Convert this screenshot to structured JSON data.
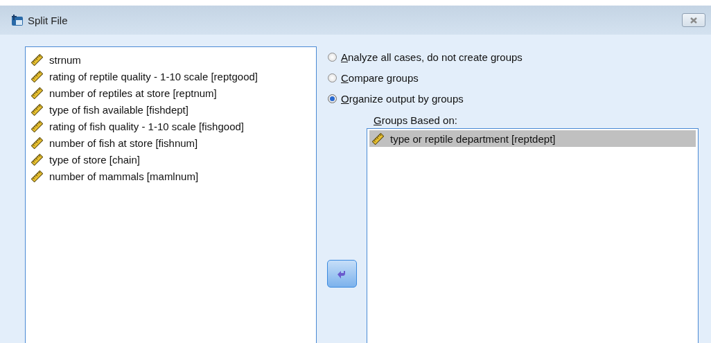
{
  "window": {
    "title": "Split File"
  },
  "variables": [
    {
      "label": "strnum",
      "selected": false
    },
    {
      "label": "rating of reptile quality - 1-10 scale [reptgood]",
      "selected": false
    },
    {
      "label": "number of reptiles at store [reptnum]",
      "selected": false
    },
    {
      "label": "type of fish available [fishdept]",
      "selected": false
    },
    {
      "label": "rating of fish quality - 1-10 scale [fishgood]",
      "selected": false
    },
    {
      "label": "number of fish at store [fishnum]",
      "selected": false
    },
    {
      "label": "type of store [chain]",
      "selected": false
    },
    {
      "label": "number of mammals [mamlnum]",
      "selected": false
    }
  ],
  "options": [
    {
      "label": "Analyze all cases, do not create groups",
      "selected": false
    },
    {
      "label": "Compare groups",
      "selected": false
    },
    {
      "label": "Organize output by groups",
      "selected": true
    }
  ],
  "groups": {
    "label": "Groups Based on:",
    "items": [
      {
        "label": "type or reptile department [reptdept]",
        "selected": true
      }
    ]
  }
}
